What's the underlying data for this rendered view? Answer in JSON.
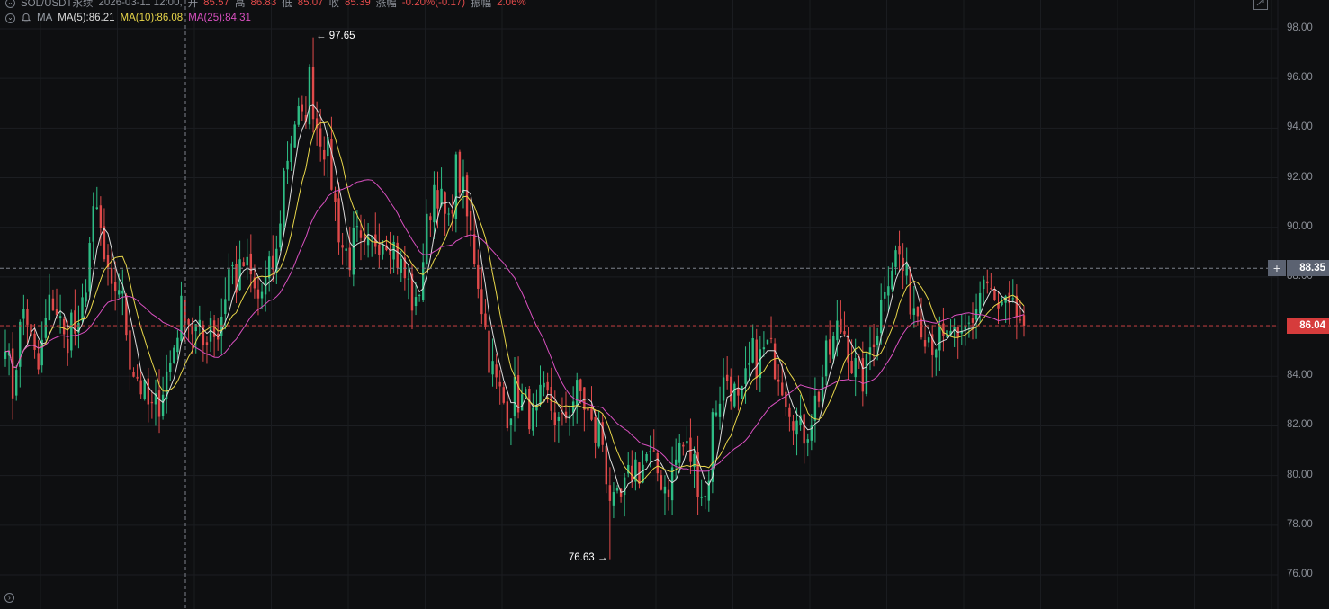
{
  "header": {
    "symbol": "SOL/USDT永续",
    "timestamp": "2026-03-11 12:00,",
    "open_label": "开",
    "open_value": "85.57",
    "high_label": "高",
    "high_value": "86.83",
    "low_label": "低",
    "low_value": "85.07",
    "close_label": "收",
    "close_value": "85.39",
    "change_label": "涨幅",
    "change_value": "-0.20%(-0.17)",
    "amplitude_label": "振幅",
    "amplitude_value": "2.06%"
  },
  "indicator": {
    "name": "MA",
    "ma5_text": "MA(5):86.21",
    "ma10_text": "MA(10):86.08",
    "ma25_text": "MA(25):84.31"
  },
  "price_axis": {
    "ticks": [
      "98.00",
      "96.00",
      "94.00",
      "92.00",
      "90.00",
      "88.00",
      "86.00",
      "84.00",
      "82.00",
      "80.00",
      "78.00",
      "76.00"
    ],
    "crosshair_price": "88.35",
    "last_price": "86.04"
  },
  "annotations": {
    "high_marker": "97.65",
    "low_marker": "76.63"
  },
  "colors": {
    "background": "#0e0f11",
    "up": "#2ebd85",
    "down": "#e04a4a",
    "ma5": "#dcdcdc",
    "ma10": "#e8d64a",
    "ma25": "#d950c0",
    "last_price_tag": "#d63c3c",
    "crosshair_tag": "#5b6271"
  },
  "chart_data": {
    "type": "candlestick",
    "symbol": "SOL/USDT永续",
    "ylim": [
      75.0,
      98.5
    ],
    "y_ticks": [
      76,
      78,
      80,
      82,
      84,
      86,
      88,
      90,
      92,
      94,
      96,
      98
    ],
    "crosshair_price": 88.35,
    "last_price": 86.04,
    "marked_high": 97.65,
    "marked_low": 76.63,
    "price_path": [
      85.8,
      83.2,
      85.5,
      87.0,
      85.0,
      84.2,
      86.0,
      87.2,
      86.5,
      85.2,
      86.3,
      85.3,
      87.5,
      90.0,
      90.6,
      88.5,
      87.0,
      88.0,
      86.5,
      84.5,
      84.0,
      83.2,
      82.5,
      82.8,
      83.8,
      84.6,
      86.0,
      87.0,
      86.0,
      85.8,
      85.2,
      86.5,
      85.5,
      87.0,
      88.6,
      87.7,
      88.5,
      88.0,
      87.0,
      87.5,
      88.2,
      88.8,
      92.0,
      93.4,
      94.6,
      94.0,
      96.0,
      94.2,
      93.6,
      92.6,
      90.5,
      89.2,
      88.8,
      89.6,
      88.7,
      89.0,
      89.6,
      89.7,
      89.8,
      89.0,
      88.2,
      87.6,
      86.5,
      88.5,
      90.5,
      92.0,
      90.8,
      89.8,
      92.4,
      91.7,
      90.0,
      88.8,
      87.0,
      85.0,
      83.8,
      83.1,
      82.6,
      83.3,
      83.0,
      82.8,
      81.9,
      83.0,
      83.0,
      82.5,
      81.7,
      82.7,
      83.2,
      83.3,
      82.5,
      81.5,
      82.0,
      79.8,
      78.5,
      78.9,
      79.6,
      80.5,
      80.2,
      80.8,
      80.3,
      80.0,
      79.5,
      80.2,
      81.3,
      81.0,
      80.6,
      79.6,
      79.0,
      82.5,
      83.3,
      84.0,
      83.5,
      82.5,
      83.8,
      84.8,
      84.6,
      85.2,
      84.8,
      84.3,
      83.4,
      82.7,
      81.7,
      81.8,
      82.6,
      83.4,
      84.6,
      85.2,
      86.0,
      85.8,
      84.5,
      84.0,
      83.9,
      85.6,
      86.2,
      88.0,
      88.6,
      89.0,
      88.0,
      87.0,
      86.7,
      86.0,
      85.5,
      85.5,
      85.1,
      86.0,
      84.8,
      85.7,
      86.2,
      87.0,
      88.0,
      87.2,
      86.5,
      86.7,
      86.3,
      86.5,
      86.04
    ],
    "candle_count": 279,
    "series": [
      {
        "name": "MA(5)",
        "last": 86.21
      },
      {
        "name": "MA(10)",
        "last": 86.08
      },
      {
        "name": "MA(25)",
        "last": 84.31
      }
    ]
  }
}
